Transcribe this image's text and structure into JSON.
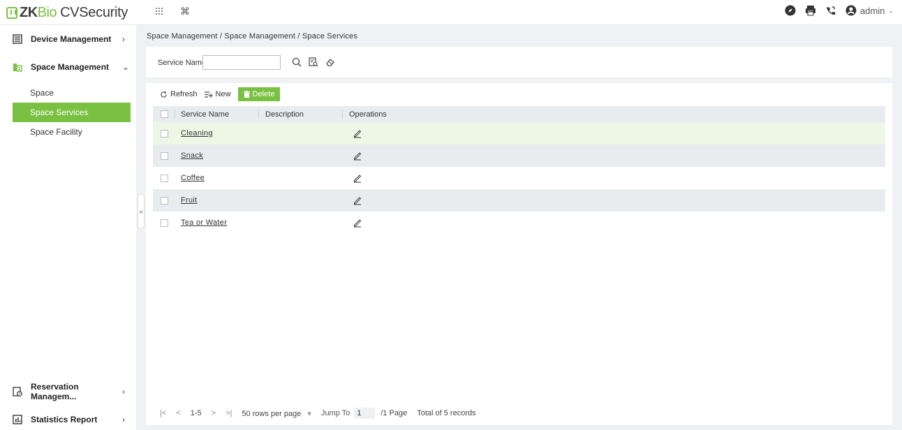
{
  "header": {
    "logo_brand_zk": "ZK",
    "logo_brand_bio": "Bio",
    "logo_product": "CVSecurity",
    "user_name": "admin"
  },
  "sidebar": {
    "groups": [
      {
        "label": "Device Management",
        "icon": "device-icon"
      },
      {
        "label": "Space Management",
        "icon": "building-icon"
      },
      {
        "label": "Reservation Managem...",
        "icon": "reservation-icon"
      },
      {
        "label": "Statistics Report",
        "icon": "chart-icon"
      }
    ],
    "sub_items": [
      {
        "label": "Space"
      },
      {
        "label": "Space Services"
      },
      {
        "label": "Space Facility"
      }
    ],
    "active_color": "#7ac143"
  },
  "breadcrumb": "Space Management / Space Management / Space Services",
  "search": {
    "label": "Service Name",
    "value": ""
  },
  "toolbar": {
    "refresh_label": "Refresh",
    "new_label": "New",
    "delete_label": "Delete"
  },
  "table": {
    "headers": [
      "Service Name",
      "Description",
      "Operations"
    ],
    "rows": [
      {
        "name": "Cleaning",
        "description": ""
      },
      {
        "name": "Snack",
        "description": ""
      },
      {
        "name": "Coffee",
        "description": ""
      },
      {
        "name": "Fruit",
        "description": ""
      },
      {
        "name": "Tea or Water",
        "description": ""
      }
    ]
  },
  "pager": {
    "range": "1-5",
    "rows_per_page": "50 rows per page",
    "jump_label": "Jump To",
    "jump_value": "1",
    "page_total": "/1 Page",
    "records": "Total of 5 records"
  }
}
